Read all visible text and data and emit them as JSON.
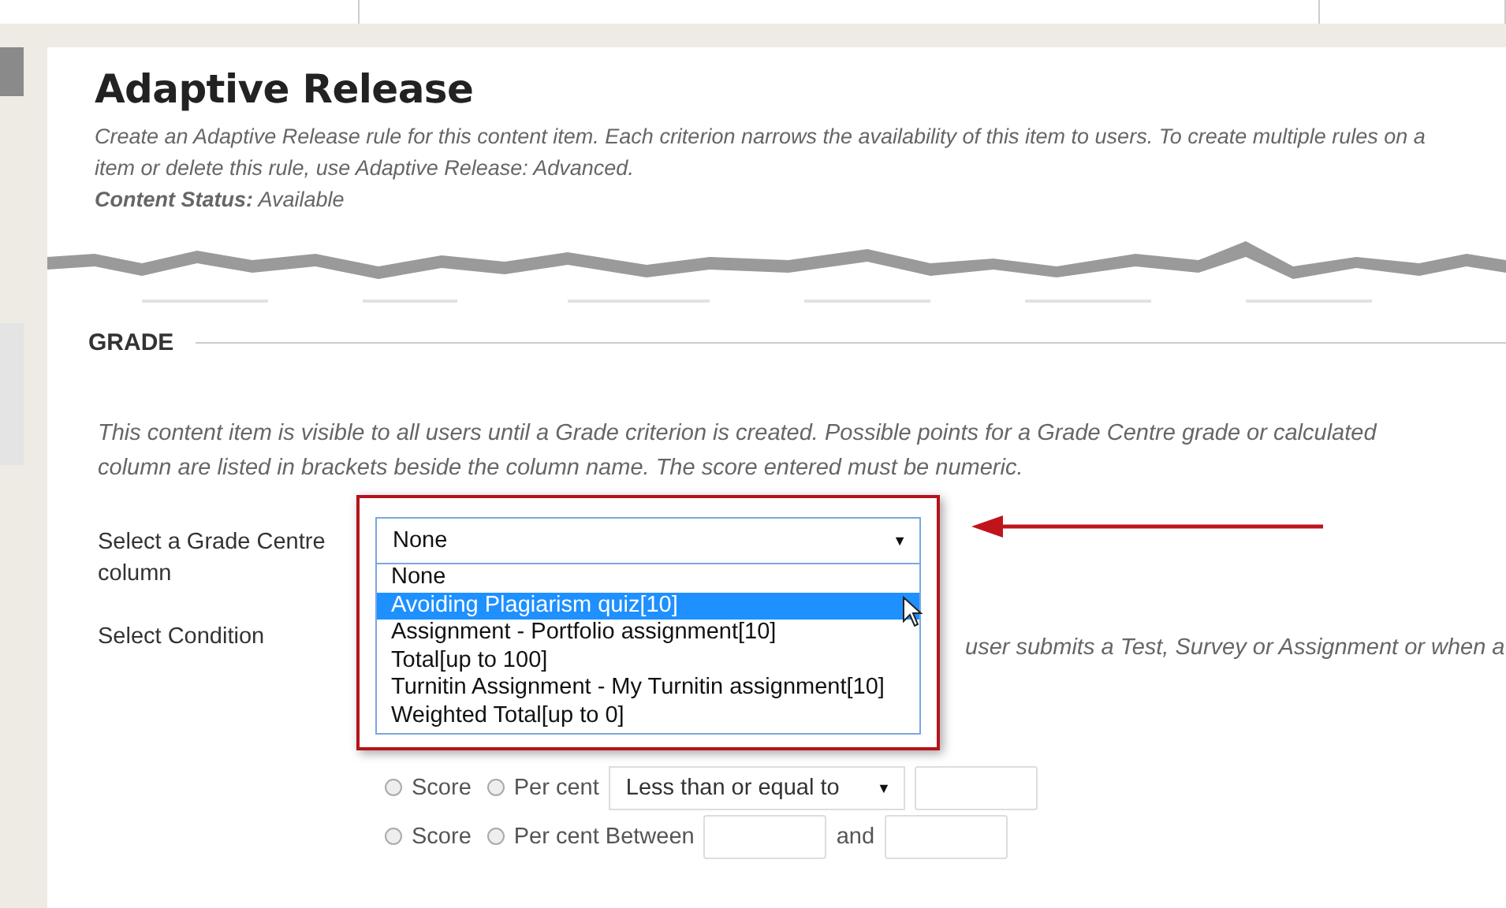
{
  "page": {
    "title": "Adaptive Release",
    "description_lines": [
      "Create an Adaptive Release rule for this content item. Each criterion narrows the availability of this item to users. To create multiple rules on a",
      "item or delete this rule, use Adaptive Release: Advanced."
    ],
    "content_status": "**Content Status:** Available"
  },
  "grade": {
    "heading": "GRADE",
    "intro": "This content item is visible to all users until a Grade criterion is created. Possible points for a Grade Centre grade or calculated column are listed in brackets beside the column name. The score entered must be numeric.",
    "column_label": "Select a Grade Centre column",
    "column_select": {
      "value": "None",
      "arrow": "▼",
      "expanded": true,
      "options": [
        {
          "label": "None",
          "highlighted": false
        },
        {
          "label": "Avoiding Plagiarism quiz[10]",
          "highlighted": true
        },
        {
          "label": "Assignment - Portfolio assignment[10]",
          "highlighted": false
        },
        {
          "label": "Total[up to 100]",
          "highlighted": false
        },
        {
          "label": "Turnitin Assignment - My Turnitin assignment[10]",
          "highlighted": false
        },
        {
          "label": "Weighted Total[up to 0]",
          "highlighted": false
        }
      ]
    },
    "condition_label": "Select Condition",
    "condition_hint": "user submits a Test, Survey or Assignment or when a",
    "condition_rows": [
      {
        "kind": "compare",
        "options": [
          {
            "label": "Score",
            "checked": false
          },
          {
            "label": "Per cent",
            "checked": false
          }
        ],
        "operator": "Less than or equal to",
        "arrow": "▼"
      },
      {
        "kind": "between",
        "options": [
          {
            "label": "Score",
            "checked": false
          },
          {
            "label": "Per cent Between",
            "checked": false
          }
        ],
        "joiner": "and"
      }
    ]
  }
}
